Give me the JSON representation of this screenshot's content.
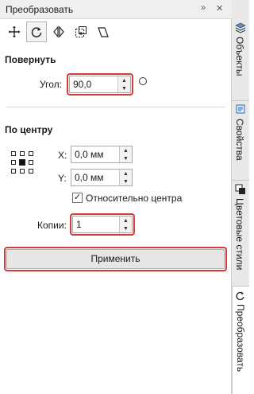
{
  "panel": {
    "title": "Преобразовать",
    "controls": [
      "»",
      "✕"
    ]
  },
  "toolbar": {
    "buttons": [
      {
        "name": "position-tool",
        "icon": "move-cross-icon",
        "active": false
      },
      {
        "name": "rotate-tool",
        "icon": "rotate-icon",
        "active": true
      },
      {
        "name": "mirror-tool",
        "icon": "mirror-icon",
        "active": false
      },
      {
        "name": "scale-tool",
        "icon": "scale-icon",
        "active": false
      },
      {
        "name": "skew-tool",
        "icon": "skew-icon",
        "active": false
      }
    ]
  },
  "rotate": {
    "section_title": "Повернуть",
    "angle_label": "Угол:",
    "angle_value": "90,0"
  },
  "center": {
    "section_title": "По центру",
    "x_label": "X:",
    "x_value": "0,0 мм",
    "y_label": "Y:",
    "y_value": "0,0 мм",
    "relative_label": "Относительно центра",
    "relative_checked": true
  },
  "copies": {
    "label": "Копии:",
    "value": "1"
  },
  "apply_label": "Применить",
  "highlight_color": "#d63a3a",
  "side_tabs": [
    {
      "label": "Объекты",
      "icon": "layers-icon"
    },
    {
      "label": "Свойства",
      "icon": "properties-icon"
    },
    {
      "label": "Цветовые стили",
      "icon": "color-styles-icon"
    },
    {
      "label": "Преобразовать",
      "icon": "transform-icon",
      "active": true
    }
  ]
}
